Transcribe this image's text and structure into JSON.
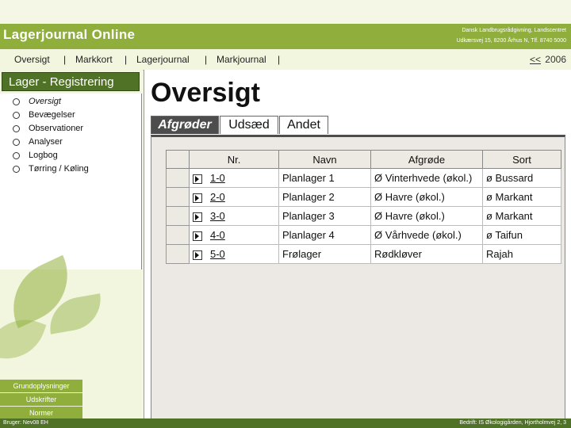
{
  "header": {
    "app_title": "Lagerjournal Online",
    "org_line1": "Dansk Landbrugsrådgivning, Landscentret",
    "org_line2": "Udkærsvej 15, 8200 Århus N, Tlf. 8740 5000"
  },
  "nav": {
    "items": [
      "Oversigt",
      "Markkort",
      "Lagerjournal",
      "Markjournal"
    ],
    "separator": "|",
    "prev": "<<",
    "year": "2006"
  },
  "sidebar": {
    "heading": "Lager - Registrering",
    "items": [
      "Oversigt",
      "Bevægelser",
      "Observationer",
      "Analyser",
      "Logbog",
      "Tørring / Køling"
    ],
    "buttons": [
      "Grundoplysninger",
      "Udskrifter",
      "Normer"
    ]
  },
  "main": {
    "title": "Oversigt",
    "tabs": [
      "Afgrøder",
      "Udsæd",
      "Andet"
    ],
    "table": {
      "columns": [
        "Nr.",
        "Navn",
        "Afgrøde",
        "Sort"
      ],
      "rows": [
        {
          "nr": "1-0",
          "navn": "Planlager 1",
          "afgrode": "Ø Vinterhvede (økol.)",
          "sort": "ø Bussard"
        },
        {
          "nr": "2-0",
          "navn": "Planlager 2",
          "afgrode": "Ø Havre (økol.)",
          "sort": "ø Markant"
        },
        {
          "nr": "3-0",
          "navn": "Planlager 3",
          "afgrode": "Ø Havre (økol.)",
          "sort": "ø Markant"
        },
        {
          "nr": "4-0",
          "navn": "Planlager 4",
          "afgrode": "Ø Vårhvede (økol.)",
          "sort": "ø Taifun"
        },
        {
          "nr": "5-0",
          "navn": "Frølager",
          "afgrode": "Rødkløver",
          "sort": "Rajah"
        }
      ]
    }
  },
  "footer": {
    "left": "Bruger: Nev08 EH",
    "right": "Bedrift: IS Økologigården, Hjortholmvej 2, 3"
  },
  "colors": {
    "brand_green": "#8fae3c",
    "dark_green": "#4f7226"
  }
}
